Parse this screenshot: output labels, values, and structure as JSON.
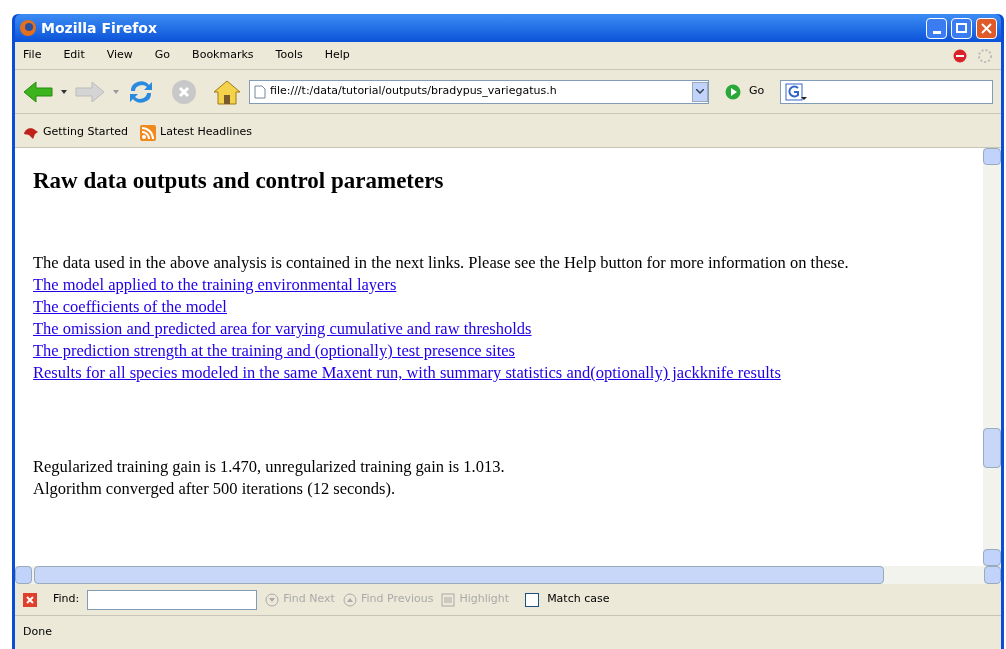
{
  "window": {
    "title": "Mozilla Firefox"
  },
  "menu": [
    "File",
    "Edit",
    "View",
    "Go",
    "Bookmarks",
    "Tools",
    "Help"
  ],
  "address": {
    "value": "file:///t:/data/tutorial/outputs/bradypus_variegatus.h"
  },
  "go_label": "Go",
  "bookmarks": [
    {
      "label": "Getting Started",
      "kind": "page"
    },
    {
      "label": "Latest Headlines",
      "kind": "feed"
    }
  ],
  "page": {
    "heading": "Raw data outputs and control parameters",
    "intro": "The data used in the above analysis is contained in the next links. Please see the Help button for more information on these.",
    "links": [
      "The model applied to the training environmental layers",
      "The coefficients of the model",
      "The omission and predicted area for varying cumulative and raw thresholds",
      "The prediction strength at the training and (optionally) test presence sites",
      "Results for all species modeled in the same Maxent run, with summary statistics and(optionally) jackknife results"
    ],
    "notes": [
      "Regularized training gain is 1.470, unregularized training gain is 1.013.",
      "Algorithm converged after 500 iterations (12 seconds)."
    ]
  },
  "find_bar": {
    "label": "Find:",
    "buttons": [
      {
        "label": "Find Next",
        "kind": "down",
        "disabled": true
      },
      {
        "label": "Find Previous",
        "kind": "up",
        "disabled": true
      },
      {
        "label": "Highlight",
        "kind": "highlight",
        "disabled": true
      }
    ],
    "match_case": {
      "label": "Match case",
      "checked": false
    }
  },
  "status_bar": "Done"
}
